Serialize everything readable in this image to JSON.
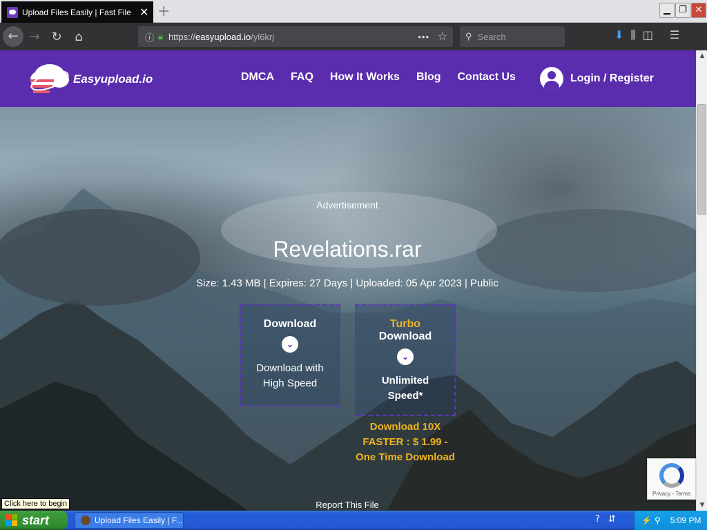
{
  "browser": {
    "tab_title": "Upload Files Easily | Fast File Upload",
    "url_prefix": "https://",
    "url_host": "easyupload.io",
    "url_path": "/yl6krj",
    "search_placeholder": "Search"
  },
  "site": {
    "logo_text": "Easyupload.io",
    "menu": [
      "DMCA",
      "FAQ",
      "How It Works",
      "Blog",
      "Contact Us"
    ],
    "login_label": "Login / Register",
    "colors": {
      "brand_purple": "#5a2dae",
      "accent_gold": "#f0b41e"
    }
  },
  "main": {
    "ad_label": "Advertisement",
    "file_name": "Revelations.rar",
    "file_meta": "Size: 1.43 MB | Expires: 27 Days | Uploaded: 05 Apr 2023 | Public",
    "download": {
      "title": "Download",
      "desc_line1": "Download with",
      "desc_line2": "High Speed"
    },
    "turbo": {
      "label": "Turbo",
      "title": "Download",
      "desc_line1": "Unlimited",
      "desc_line2": "Speed*",
      "price_line1": "Download 10X",
      "price_line2": "FASTER : $ 1.99 -",
      "price_line3": "One Time Download"
    },
    "report_label": "Report This File"
  },
  "recaptcha": {
    "text": "Privacy - Terms"
  },
  "taskbar": {
    "start_label": "start",
    "tooltip": "Click here to begin",
    "task_item": "Upload Files Easily | F...",
    "clock": "5:09 PM"
  }
}
